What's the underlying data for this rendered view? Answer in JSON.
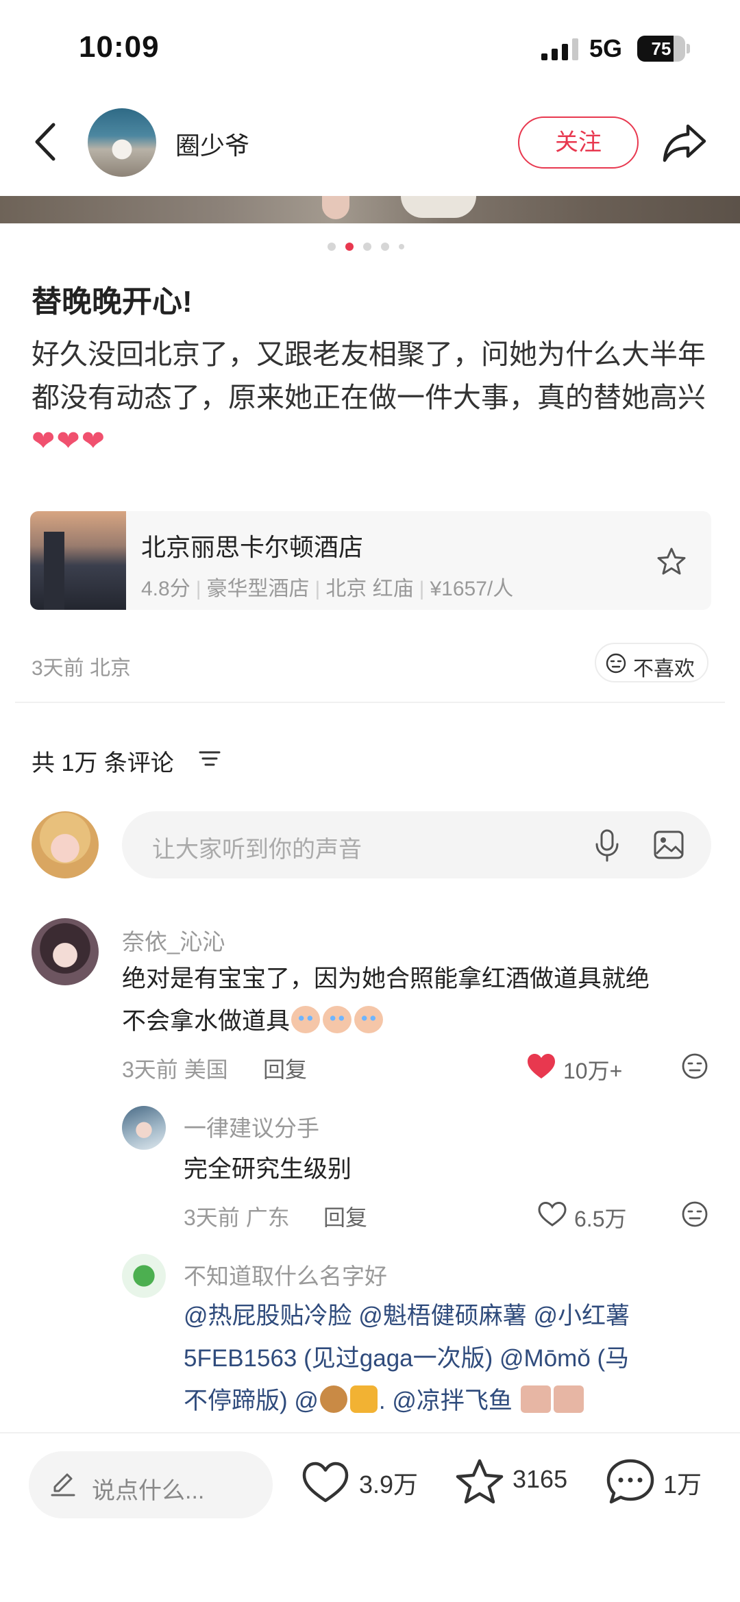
{
  "status_bar": {
    "time": "10:09",
    "network": "5G",
    "battery": "75",
    "battery_level": 0.75
  },
  "header": {
    "author_name": "圈少爷",
    "follow_label": "关注"
  },
  "carousel": {
    "total": 5,
    "active_index": 1
  },
  "post": {
    "title": "替晚晚开心!",
    "body": "好久没回北京了，又跟老友相聚了，问她为什么大半年都没有动态了，原来她正在做一件大事，真的替她高兴",
    "hearts": "❤❤❤"
  },
  "hotel": {
    "name": "北京丽思卡尔顿酒店",
    "rating": "4.8分",
    "type": "豪华型酒店",
    "location": "北京 红庙",
    "price": "¥1657/人"
  },
  "meta": {
    "time_location": "3天前 北京",
    "dislike_label": "不喜欢"
  },
  "comments_header": {
    "label": "共 1万 条评论"
  },
  "comment_input": {
    "placeholder": "让大家听到你的声音"
  },
  "comments": [
    {
      "name": "奈依_沁沁",
      "line1": "绝对是有宝宝了，因为她合照能拿红酒做道具就绝",
      "line2": "不会拿水做道具",
      "meta": "3天前 美国",
      "reply_label": "回复",
      "likes": "10万+"
    },
    {
      "name": "一律建议分手",
      "text": "完全研究生级别",
      "meta": "3天前 广东",
      "reply_label": "回复",
      "likes": "6.5万"
    },
    {
      "name": "不知道取什么名字好",
      "line1": "@热屁股贴冷脸 @魁梧健硕麻薯 @小红薯",
      "line2": "5FEB1563 (见过gaga一次版) @Mōmǒ (马",
      "line3a": "不停蹄版) @",
      "line3b": ". @凉拌飞鱼"
    }
  ],
  "bottom_bar": {
    "placeholder": "说点什么...",
    "likes": "3.9万",
    "collects": "3165",
    "comments": "1万"
  }
}
